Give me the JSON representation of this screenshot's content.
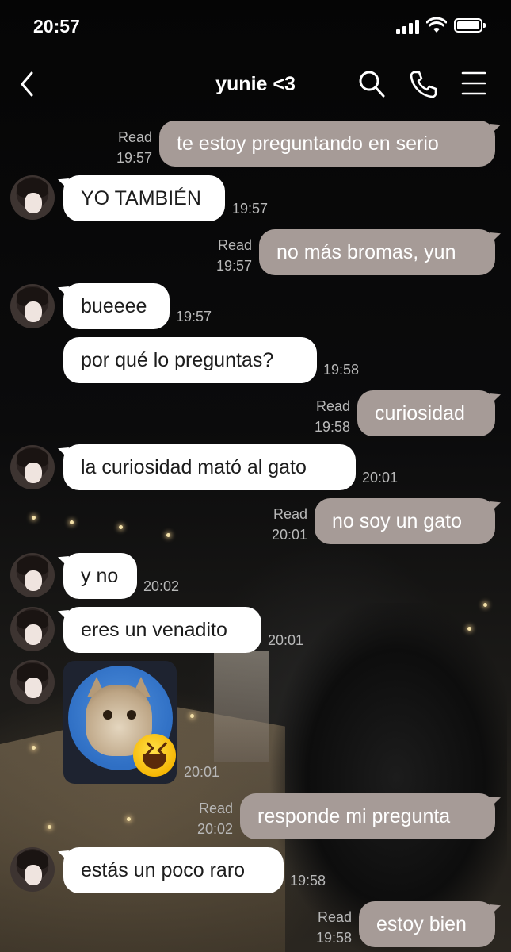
{
  "status_bar": {
    "time": "20:57"
  },
  "header": {
    "title": "yunie <3"
  },
  "messages": [
    {
      "dir": "out",
      "text": "te estoy preguntando en serio",
      "read": "Read",
      "time": "19:57"
    },
    {
      "dir": "in",
      "text": "YO TAMBIÉN",
      "time": "19:57"
    },
    {
      "dir": "out",
      "text": "no más bromas, yun",
      "read": "Read",
      "time": "19:57"
    },
    {
      "dir": "in",
      "text": "bueeee",
      "time": "19:57"
    },
    {
      "dir": "in",
      "text": "por qué lo preguntas?",
      "time": "19:58"
    },
    {
      "dir": "out",
      "text": "curiosidad",
      "read": "Read",
      "time": "19:58"
    },
    {
      "dir": "in",
      "text": "la curiosidad mató al gato",
      "time": "20:01"
    },
    {
      "dir": "out",
      "text": "no soy un gato",
      "read": "Read",
      "time": "20:01"
    },
    {
      "dir": "in",
      "text": "y no",
      "time": "20:02"
    },
    {
      "dir": "in",
      "text": "eres un venadito",
      "time": "20:01"
    },
    {
      "dir": "in",
      "type": "sticker",
      "sticker": "cat-laughing-sticker",
      "time": "20:01"
    },
    {
      "dir": "out",
      "text": "responde mi pregunta",
      "read": "Read",
      "time": "20:02"
    },
    {
      "dir": "in",
      "text": "estás un poco raro",
      "time": "19:58"
    },
    {
      "dir": "out",
      "text": "estoy bien",
      "read": "Read",
      "time": "19:58"
    }
  ],
  "icons": {
    "back": "chevron-left-icon",
    "search": "search-icon",
    "call": "phone-icon",
    "menu": "menu-icon"
  },
  "colors": {
    "outgoing_bubble": "#a69b97",
    "incoming_bubble": "#ffffff",
    "meta_text": "#b8b8b8"
  }
}
